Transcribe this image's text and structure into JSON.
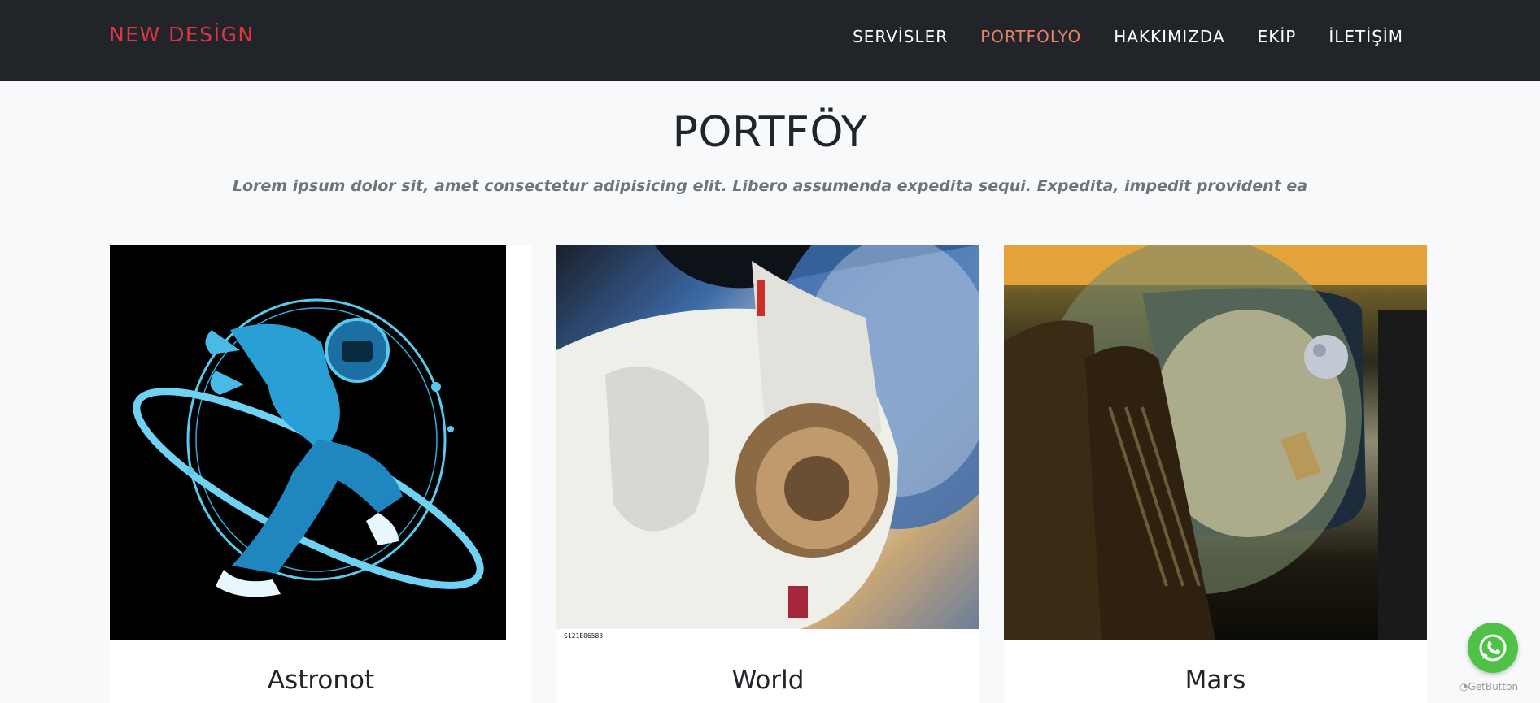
{
  "navbar": {
    "brand": "NEW DESİGN",
    "items": [
      {
        "label": "SERVİSLER"
      },
      {
        "label": "PORTFOLYO",
        "active": true
      },
      {
        "label": "HAKKIMIZDA"
      },
      {
        "label": "EKİP"
      },
      {
        "label": "İLETİŞİM"
      }
    ]
  },
  "portfolio": {
    "title": "PORTFÖY",
    "subtitle": "Lorem ipsum dolor sit, amet consectetur adipisicing elit. Libero assumenda expedita sequi. Expedita, impedit provident ea",
    "cards": [
      {
        "caption": "Astronot",
        "image": "astronaut-illustration"
      },
      {
        "caption": "World",
        "image": "astronaut-photo",
        "tag": "S121E06583"
      },
      {
        "caption": "Mars",
        "image": "spaceship-window"
      }
    ]
  },
  "whatsapp": {
    "icon": "whatsapp-icon",
    "label": "GetButton",
    "accent": "#4dc247"
  },
  "colors": {
    "navbar_bg": "#212529",
    "brand": "#dc3545",
    "nav_active": "#e8806a"
  }
}
